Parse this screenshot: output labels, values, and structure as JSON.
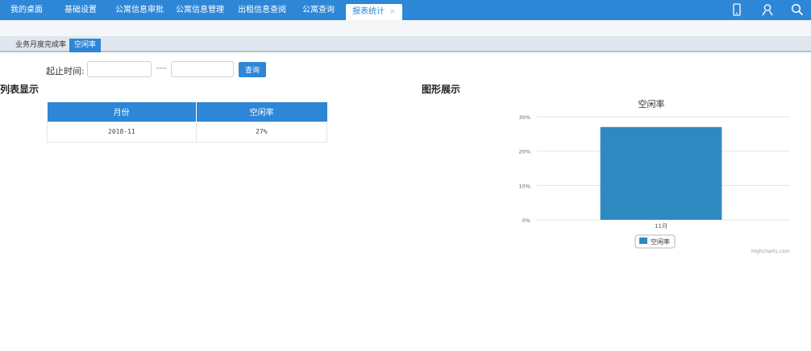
{
  "nav": {
    "items": [
      {
        "label": "我的桌面"
      },
      {
        "label": "基础设置"
      },
      {
        "label": "公寓信息审批"
      },
      {
        "label": "公寓信息管理"
      },
      {
        "label": "出租信息查阅"
      },
      {
        "label": "公寓查询"
      },
      {
        "label": "报表统计"
      }
    ],
    "active_close": "×",
    "icons": [
      "phone-icon",
      "user-icon",
      "search-icon"
    ]
  },
  "subtabs": [
    {
      "label": "业务月度完成率"
    },
    {
      "label": "空闲率"
    }
  ],
  "query": {
    "label": "起止时间:",
    "start_value": "",
    "dash": "----",
    "end_value": "",
    "button": "查询"
  },
  "list_section": {
    "title": "列表显示"
  },
  "chart_section": {
    "title": "图形展示"
  },
  "table": {
    "headers": [
      "月份",
      "空闲率"
    ],
    "rows": [
      [
        "2018-11",
        "27%"
      ]
    ]
  },
  "chart_data": {
    "type": "bar",
    "title": "空闲率",
    "categories": [
      "11月"
    ],
    "series": [
      {
        "name": "空闲率",
        "values": [
          27
        ]
      }
    ],
    "yticks": [
      "0%",
      "10%",
      "20%",
      "30%"
    ],
    "ylim": [
      0,
      30
    ],
    "grid": true,
    "legend": "bottom-center",
    "color": "#2f89c1",
    "credits": "Highcharts.com"
  },
  "colors": {
    "brand": "#2e86d6",
    "bar": "#2f89c1"
  }
}
